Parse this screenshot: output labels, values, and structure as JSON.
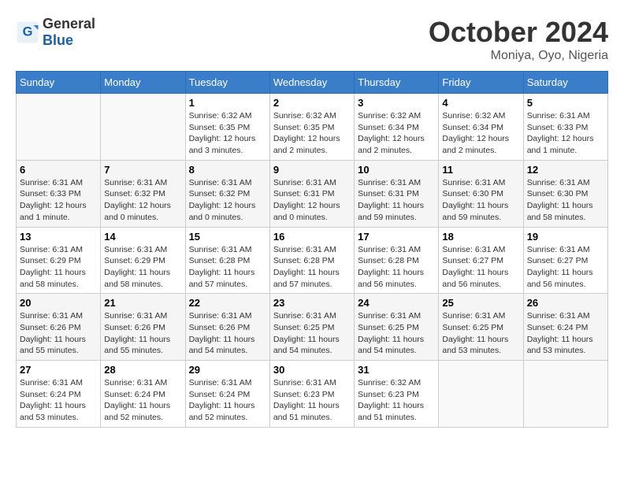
{
  "header": {
    "logo_general": "General",
    "logo_blue": "Blue",
    "month_title": "October 2024",
    "location": "Moniya, Oyo, Nigeria"
  },
  "weekdays": [
    "Sunday",
    "Monday",
    "Tuesday",
    "Wednesday",
    "Thursday",
    "Friday",
    "Saturday"
  ],
  "weeks": [
    [
      {
        "day": "",
        "info": ""
      },
      {
        "day": "",
        "info": ""
      },
      {
        "day": "1",
        "info": "Sunrise: 6:32 AM\nSunset: 6:35 PM\nDaylight: 12 hours and 3 minutes."
      },
      {
        "day": "2",
        "info": "Sunrise: 6:32 AM\nSunset: 6:35 PM\nDaylight: 12 hours and 2 minutes."
      },
      {
        "day": "3",
        "info": "Sunrise: 6:32 AM\nSunset: 6:34 PM\nDaylight: 12 hours and 2 minutes."
      },
      {
        "day": "4",
        "info": "Sunrise: 6:32 AM\nSunset: 6:34 PM\nDaylight: 12 hours and 2 minutes."
      },
      {
        "day": "5",
        "info": "Sunrise: 6:31 AM\nSunset: 6:33 PM\nDaylight: 12 hours and 1 minute."
      }
    ],
    [
      {
        "day": "6",
        "info": "Sunrise: 6:31 AM\nSunset: 6:33 PM\nDaylight: 12 hours and 1 minute."
      },
      {
        "day": "7",
        "info": "Sunrise: 6:31 AM\nSunset: 6:32 PM\nDaylight: 12 hours and 0 minutes."
      },
      {
        "day": "8",
        "info": "Sunrise: 6:31 AM\nSunset: 6:32 PM\nDaylight: 12 hours and 0 minutes."
      },
      {
        "day": "9",
        "info": "Sunrise: 6:31 AM\nSunset: 6:31 PM\nDaylight: 12 hours and 0 minutes."
      },
      {
        "day": "10",
        "info": "Sunrise: 6:31 AM\nSunset: 6:31 PM\nDaylight: 11 hours and 59 minutes."
      },
      {
        "day": "11",
        "info": "Sunrise: 6:31 AM\nSunset: 6:30 PM\nDaylight: 11 hours and 59 minutes."
      },
      {
        "day": "12",
        "info": "Sunrise: 6:31 AM\nSunset: 6:30 PM\nDaylight: 11 hours and 58 minutes."
      }
    ],
    [
      {
        "day": "13",
        "info": "Sunrise: 6:31 AM\nSunset: 6:29 PM\nDaylight: 11 hours and 58 minutes."
      },
      {
        "day": "14",
        "info": "Sunrise: 6:31 AM\nSunset: 6:29 PM\nDaylight: 11 hours and 58 minutes."
      },
      {
        "day": "15",
        "info": "Sunrise: 6:31 AM\nSunset: 6:28 PM\nDaylight: 11 hours and 57 minutes."
      },
      {
        "day": "16",
        "info": "Sunrise: 6:31 AM\nSunset: 6:28 PM\nDaylight: 11 hours and 57 minutes."
      },
      {
        "day": "17",
        "info": "Sunrise: 6:31 AM\nSunset: 6:28 PM\nDaylight: 11 hours and 56 minutes."
      },
      {
        "day": "18",
        "info": "Sunrise: 6:31 AM\nSunset: 6:27 PM\nDaylight: 11 hours and 56 minutes."
      },
      {
        "day": "19",
        "info": "Sunrise: 6:31 AM\nSunset: 6:27 PM\nDaylight: 11 hours and 56 minutes."
      }
    ],
    [
      {
        "day": "20",
        "info": "Sunrise: 6:31 AM\nSunset: 6:26 PM\nDaylight: 11 hours and 55 minutes."
      },
      {
        "day": "21",
        "info": "Sunrise: 6:31 AM\nSunset: 6:26 PM\nDaylight: 11 hours and 55 minutes."
      },
      {
        "day": "22",
        "info": "Sunrise: 6:31 AM\nSunset: 6:26 PM\nDaylight: 11 hours and 54 minutes."
      },
      {
        "day": "23",
        "info": "Sunrise: 6:31 AM\nSunset: 6:25 PM\nDaylight: 11 hours and 54 minutes."
      },
      {
        "day": "24",
        "info": "Sunrise: 6:31 AM\nSunset: 6:25 PM\nDaylight: 11 hours and 54 minutes."
      },
      {
        "day": "25",
        "info": "Sunrise: 6:31 AM\nSunset: 6:25 PM\nDaylight: 11 hours and 53 minutes."
      },
      {
        "day": "26",
        "info": "Sunrise: 6:31 AM\nSunset: 6:24 PM\nDaylight: 11 hours and 53 minutes."
      }
    ],
    [
      {
        "day": "27",
        "info": "Sunrise: 6:31 AM\nSunset: 6:24 PM\nDaylight: 11 hours and 53 minutes."
      },
      {
        "day": "28",
        "info": "Sunrise: 6:31 AM\nSunset: 6:24 PM\nDaylight: 11 hours and 52 minutes."
      },
      {
        "day": "29",
        "info": "Sunrise: 6:31 AM\nSunset: 6:24 PM\nDaylight: 11 hours and 52 minutes."
      },
      {
        "day": "30",
        "info": "Sunrise: 6:31 AM\nSunset: 6:23 PM\nDaylight: 11 hours and 51 minutes."
      },
      {
        "day": "31",
        "info": "Sunrise: 6:32 AM\nSunset: 6:23 PM\nDaylight: 11 hours and 51 minutes."
      },
      {
        "day": "",
        "info": ""
      },
      {
        "day": "",
        "info": ""
      }
    ]
  ]
}
